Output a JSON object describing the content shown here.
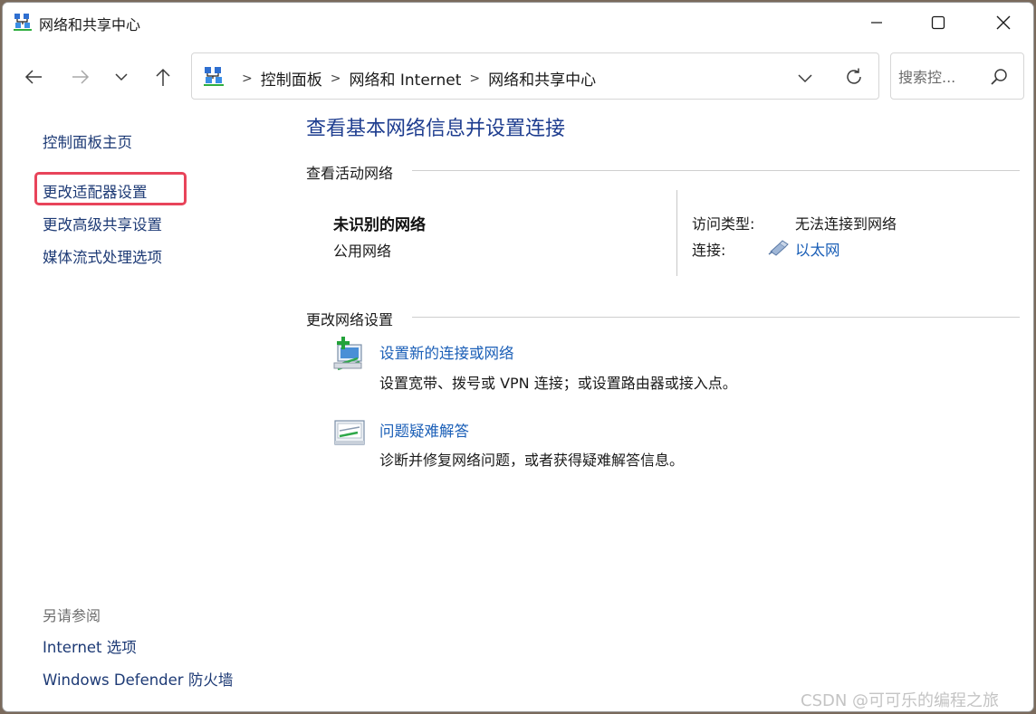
{
  "window": {
    "title": "网络和共享中心"
  },
  "controls": {
    "minimize": "minimize",
    "maximize": "maximize",
    "close": "close"
  },
  "address_bar": {
    "crumbs": [
      "控制面板",
      "网络和 Internet",
      "网络和共享中心"
    ],
    "separator": ">"
  },
  "search": {
    "placeholder": "搜索控..."
  },
  "sidebar": {
    "home": "控制面板主页",
    "items": [
      "更改适配器设置",
      "更改高级共享设置",
      "媒体流式处理选项"
    ],
    "see_also_title": "另请参阅",
    "see_also": [
      "Internet 选项",
      "Windows Defender 防火墙"
    ]
  },
  "main": {
    "title": "查看基本网络信息并设置连接",
    "active_networks_header": "查看活动网络",
    "network": {
      "name": "未识别的网络",
      "type": "公用网络",
      "access_type_label": "访问类型:",
      "access_type_value": "无法连接到网络",
      "connection_label": "连接:",
      "connection_value": "以太网"
    },
    "change_settings_header": "更改网络设置",
    "tasks": [
      {
        "title": "设置新的连接或网络",
        "description": "设置宽带、拨号或 VPN 连接；或设置路由器或接入点。"
      },
      {
        "title": "问题疑难解答",
        "description": "诊断并修复网络问题，或者获得疑难解答信息。"
      }
    ]
  },
  "watermark": "CSDN @可可乐的编程之旅",
  "colors": {
    "link": "#1b5fb7",
    "sidebar_link": "#1d3a75",
    "title": "#1e3d8f",
    "highlight": "#e8445a"
  },
  "icons": {
    "window": "network-center-icon",
    "back": "arrow-left-icon",
    "forward": "arrow-right-icon",
    "recent": "chevron-down-icon",
    "up": "arrow-up-icon",
    "refresh": "refresh-icon",
    "search": "search-icon",
    "ethernet": "ethernet-icon",
    "new_connection": "new-connection-icon",
    "troubleshoot": "troubleshoot-icon"
  }
}
